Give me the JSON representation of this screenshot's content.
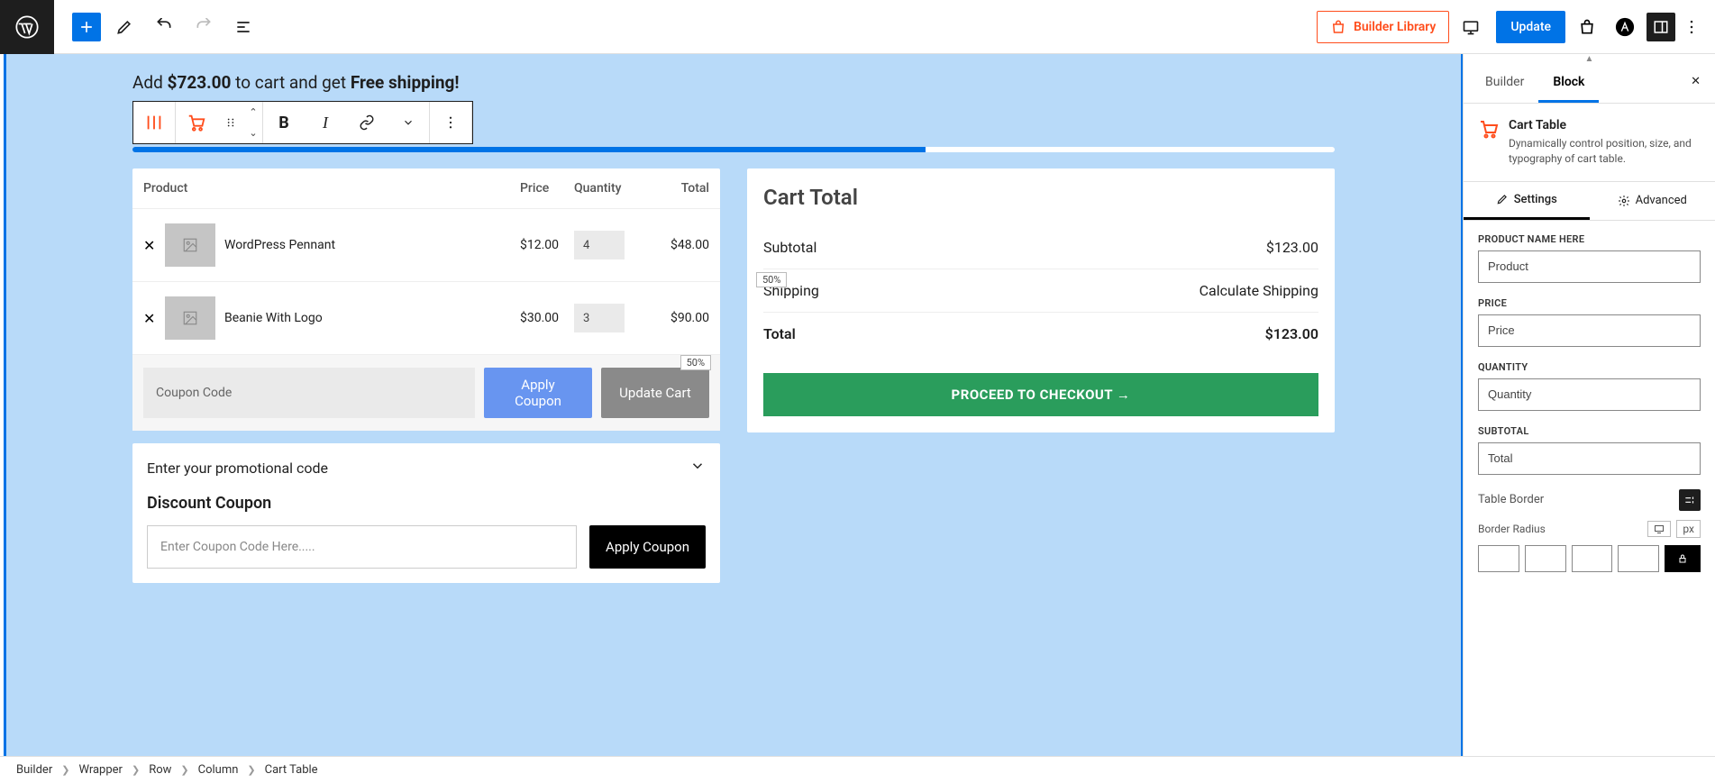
{
  "topbar": {
    "builder_library": "Builder Library",
    "update": "Update"
  },
  "banner": {
    "prefix": "Add ",
    "amount": "$723.00",
    "mid": " to cart and get ",
    "suffix": "Free shipping!"
  },
  "cart_table": {
    "headers": {
      "product": "Product",
      "price": "Price",
      "quantity": "Quantity",
      "total": "Total"
    },
    "rows": [
      {
        "name": "WordPress Pennant",
        "price": "$12.00",
        "qty": "4",
        "sub": "$48.00"
      },
      {
        "name": "Beanie With Logo",
        "price": "$30.00",
        "qty": "3",
        "sub": "$90.00"
      }
    ],
    "coupon_placeholder": "Coupon Code",
    "apply_label_1": "Apply",
    "apply_label_2": "Coupon",
    "update_label": "Update Cart",
    "update_badge": "50%"
  },
  "promo": {
    "head": "Enter your promotional code",
    "label": "Discount Coupon",
    "placeholder": "Enter Coupon Code Here.....",
    "apply": "Apply Coupon"
  },
  "cart_total": {
    "title": "Cart Total",
    "subtotal_label": "Subtotal",
    "subtotal_value": "$123.00",
    "shipping_label": "Shipping",
    "shipping_value": "Calculate Shipping",
    "ship_badge": "50%",
    "total_label": "Total",
    "total_value": "$123.00",
    "checkout": "PROCEED TO CHECKOUT →"
  },
  "sidebar": {
    "tabs": {
      "builder": "Builder",
      "block": "Block"
    },
    "block_title": "Cart Table",
    "block_desc": "Dynamically control position, size, and typography of cart table.",
    "subtabs": {
      "settings": "Settings",
      "advanced": "Advanced"
    },
    "fields": {
      "product_label": "PRODUCT NAME HERE",
      "product_value": "Product",
      "price_label": "PRICE",
      "price_value": "Price",
      "quantity_label": "QUANTITY",
      "quantity_value": "Quantity",
      "subtotal_label": "SUBTOTAL",
      "subtotal_value": "Total",
      "table_border": "Table Border",
      "border_radius": "Border Radius",
      "unit_px": "px"
    }
  },
  "breadcrumb": [
    "Builder",
    "Wrapper",
    "Row",
    "Column",
    "Cart Table"
  ]
}
